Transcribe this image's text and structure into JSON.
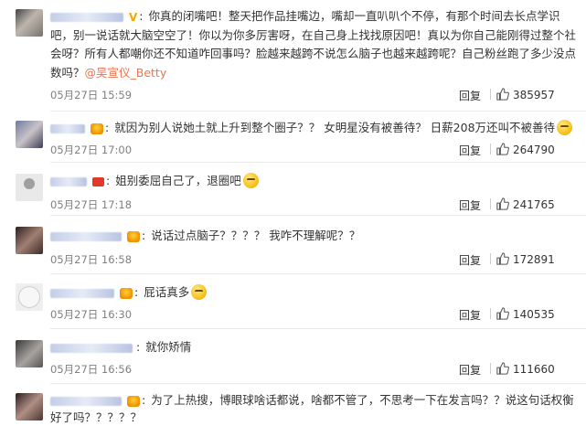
{
  "comments": [
    {
      "text": "你真的闭嘴吧！整天把作品挂嘴边，嘴却一直叭叭个不停，有那个时间去长点学识吧，别一说话就大脑空空了！你以为你多厉害呀，在自己身上找找原因吧！真以为你自己能刚得过整个社会呀？所有人都嘲你还不知道咋回事吗？脸越来越跨不说怎么脑子也越来越跨呢？自己粉丝跑了多少没点数吗？",
      "mention": "@吴宣仪_Betty",
      "time": "05月27日 15:59",
      "reply": "回复",
      "likes": "385957"
    },
    {
      "text": "就因为别人说她土就上升到整个圈子？？ 女明星没有被善待？ 日薪208万还叫不被善待",
      "time": "05月27日 17:00",
      "reply": "回复",
      "likes": "264790"
    },
    {
      "text": "姐别委屈自己了，退圈吧",
      "time": "05月27日 17:18",
      "reply": "回复",
      "likes": "241765"
    },
    {
      "text": "说话过点脑子？？？？ 我咋不理解呢？？",
      "time": "05月27日 16:58",
      "reply": "回复",
      "likes": "172891"
    },
    {
      "text": "屁话真多",
      "time": "05月27日 16:30",
      "reply": "回复",
      "likes": "140535"
    },
    {
      "text": "就你矫情",
      "time": "05月27日 16:56",
      "reply": "回复",
      "likes": "111660"
    },
    {
      "text": "为了上热搜，博眼球啥话都说，啥都不管了，不思考一下在发言吗？？说这句话权衡好了吗？？？？？"
    }
  ],
  "icons": {
    "thumb": "thumbs-up-icon",
    "emoji": "smiley-icon",
    "verified": "V"
  },
  "colors": {
    "mention": "#eb7350",
    "vip": "#f7a700",
    "meta": "#808080"
  }
}
